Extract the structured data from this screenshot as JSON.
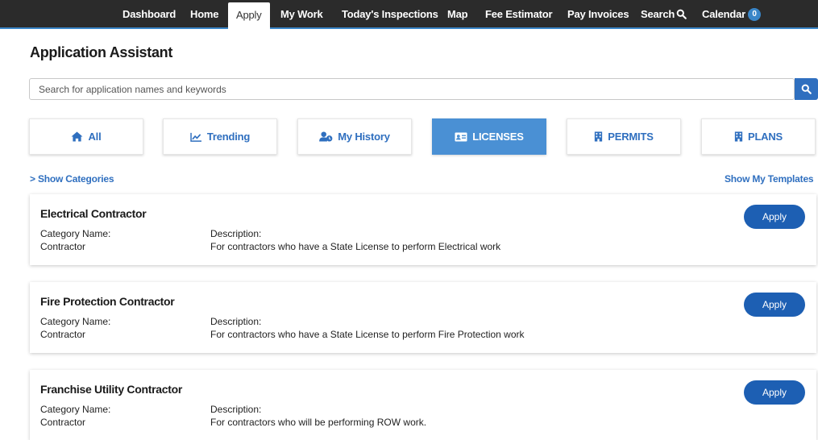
{
  "nav": {
    "items": [
      "Dashboard",
      "Home",
      "Apply",
      "My Work",
      "Today's Inspections",
      "Map",
      "Fee Estimator",
      "Pay Invoices"
    ],
    "search_label": "Search",
    "calendar_label": "Calendar",
    "calendar_count": "0",
    "active": "Apply"
  },
  "page": {
    "title": "Application Assistant"
  },
  "search": {
    "placeholder": "Search for application names and keywords",
    "value": ""
  },
  "filters": [
    "All",
    "Trending",
    "My History",
    "LICENSES",
    "PERMITS",
    "PLANS"
  ],
  "active_filter": "LICENSES",
  "links": {
    "show_categories": "> Show Categories",
    "show_templates": "Show My Templates"
  },
  "results": [
    {
      "title": "Electrical Contractor",
      "category_label": "Category Name:",
      "category": "Contractor",
      "description_label": "Description:",
      "description": "For contractors who have a State License to perform Electrical work",
      "apply_label": "Apply"
    },
    {
      "title": "Fire Protection Contractor",
      "category_label": "Category Name:",
      "category": "Contractor",
      "description_label": "Description:",
      "description": "For contractors who have a State License to perform Fire Protection work",
      "apply_label": "Apply"
    },
    {
      "title": "Franchise Utility Contractor",
      "category_label": "Category Name:",
      "category": "Contractor",
      "description_label": "Description:",
      "description": "For contractors who will be performing ROW work.",
      "apply_label": "Apply"
    }
  ],
  "colors": {
    "nav_bg": "#2b2b2b",
    "accent": "#2f6fbf",
    "active_filter_bg": "#4a90d4",
    "apply_button": "#1d5fb3"
  }
}
